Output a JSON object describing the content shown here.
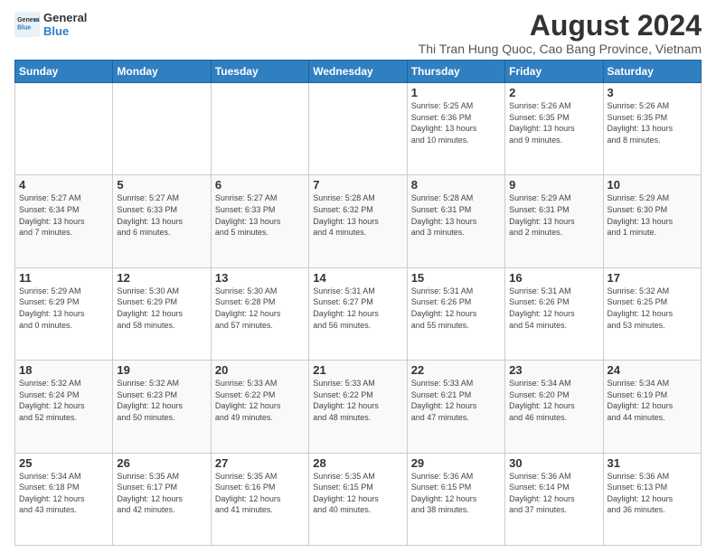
{
  "logo": {
    "line1": "General",
    "line2": "Blue"
  },
  "title": "August 2024",
  "subtitle": "Thi Tran Hung Quoc, Cao Bang Province, Vietnam",
  "days_of_week": [
    "Sunday",
    "Monday",
    "Tuesday",
    "Wednesday",
    "Thursday",
    "Friday",
    "Saturday"
  ],
  "weeks": [
    [
      {
        "day": "",
        "info": ""
      },
      {
        "day": "",
        "info": ""
      },
      {
        "day": "",
        "info": ""
      },
      {
        "day": "",
        "info": ""
      },
      {
        "day": "1",
        "info": "Sunrise: 5:25 AM\nSunset: 6:36 PM\nDaylight: 13 hours\nand 10 minutes."
      },
      {
        "day": "2",
        "info": "Sunrise: 5:26 AM\nSunset: 6:35 PM\nDaylight: 13 hours\nand 9 minutes."
      },
      {
        "day": "3",
        "info": "Sunrise: 5:26 AM\nSunset: 6:35 PM\nDaylight: 13 hours\nand 8 minutes."
      }
    ],
    [
      {
        "day": "4",
        "info": "Sunrise: 5:27 AM\nSunset: 6:34 PM\nDaylight: 13 hours\nand 7 minutes."
      },
      {
        "day": "5",
        "info": "Sunrise: 5:27 AM\nSunset: 6:33 PM\nDaylight: 13 hours\nand 6 minutes."
      },
      {
        "day": "6",
        "info": "Sunrise: 5:27 AM\nSunset: 6:33 PM\nDaylight: 13 hours\nand 5 minutes."
      },
      {
        "day": "7",
        "info": "Sunrise: 5:28 AM\nSunset: 6:32 PM\nDaylight: 13 hours\nand 4 minutes."
      },
      {
        "day": "8",
        "info": "Sunrise: 5:28 AM\nSunset: 6:31 PM\nDaylight: 13 hours\nand 3 minutes."
      },
      {
        "day": "9",
        "info": "Sunrise: 5:29 AM\nSunset: 6:31 PM\nDaylight: 13 hours\nand 2 minutes."
      },
      {
        "day": "10",
        "info": "Sunrise: 5:29 AM\nSunset: 6:30 PM\nDaylight: 13 hours\nand 1 minute."
      }
    ],
    [
      {
        "day": "11",
        "info": "Sunrise: 5:29 AM\nSunset: 6:29 PM\nDaylight: 13 hours\nand 0 minutes."
      },
      {
        "day": "12",
        "info": "Sunrise: 5:30 AM\nSunset: 6:29 PM\nDaylight: 12 hours\nand 58 minutes."
      },
      {
        "day": "13",
        "info": "Sunrise: 5:30 AM\nSunset: 6:28 PM\nDaylight: 12 hours\nand 57 minutes."
      },
      {
        "day": "14",
        "info": "Sunrise: 5:31 AM\nSunset: 6:27 PM\nDaylight: 12 hours\nand 56 minutes."
      },
      {
        "day": "15",
        "info": "Sunrise: 5:31 AM\nSunset: 6:26 PM\nDaylight: 12 hours\nand 55 minutes."
      },
      {
        "day": "16",
        "info": "Sunrise: 5:31 AM\nSunset: 6:26 PM\nDaylight: 12 hours\nand 54 minutes."
      },
      {
        "day": "17",
        "info": "Sunrise: 5:32 AM\nSunset: 6:25 PM\nDaylight: 12 hours\nand 53 minutes."
      }
    ],
    [
      {
        "day": "18",
        "info": "Sunrise: 5:32 AM\nSunset: 6:24 PM\nDaylight: 12 hours\nand 52 minutes."
      },
      {
        "day": "19",
        "info": "Sunrise: 5:32 AM\nSunset: 6:23 PM\nDaylight: 12 hours\nand 50 minutes."
      },
      {
        "day": "20",
        "info": "Sunrise: 5:33 AM\nSunset: 6:22 PM\nDaylight: 12 hours\nand 49 minutes."
      },
      {
        "day": "21",
        "info": "Sunrise: 5:33 AM\nSunset: 6:22 PM\nDaylight: 12 hours\nand 48 minutes."
      },
      {
        "day": "22",
        "info": "Sunrise: 5:33 AM\nSunset: 6:21 PM\nDaylight: 12 hours\nand 47 minutes."
      },
      {
        "day": "23",
        "info": "Sunrise: 5:34 AM\nSunset: 6:20 PM\nDaylight: 12 hours\nand 46 minutes."
      },
      {
        "day": "24",
        "info": "Sunrise: 5:34 AM\nSunset: 6:19 PM\nDaylight: 12 hours\nand 44 minutes."
      }
    ],
    [
      {
        "day": "25",
        "info": "Sunrise: 5:34 AM\nSunset: 6:18 PM\nDaylight: 12 hours\nand 43 minutes."
      },
      {
        "day": "26",
        "info": "Sunrise: 5:35 AM\nSunset: 6:17 PM\nDaylight: 12 hours\nand 42 minutes."
      },
      {
        "day": "27",
        "info": "Sunrise: 5:35 AM\nSunset: 6:16 PM\nDaylight: 12 hours\nand 41 minutes."
      },
      {
        "day": "28",
        "info": "Sunrise: 5:35 AM\nSunset: 6:15 PM\nDaylight: 12 hours\nand 40 minutes."
      },
      {
        "day": "29",
        "info": "Sunrise: 5:36 AM\nSunset: 6:15 PM\nDaylight: 12 hours\nand 38 minutes."
      },
      {
        "day": "30",
        "info": "Sunrise: 5:36 AM\nSunset: 6:14 PM\nDaylight: 12 hours\nand 37 minutes."
      },
      {
        "day": "31",
        "info": "Sunrise: 5:36 AM\nSunset: 6:13 PM\nDaylight: 12 hours\nand 36 minutes."
      }
    ]
  ]
}
